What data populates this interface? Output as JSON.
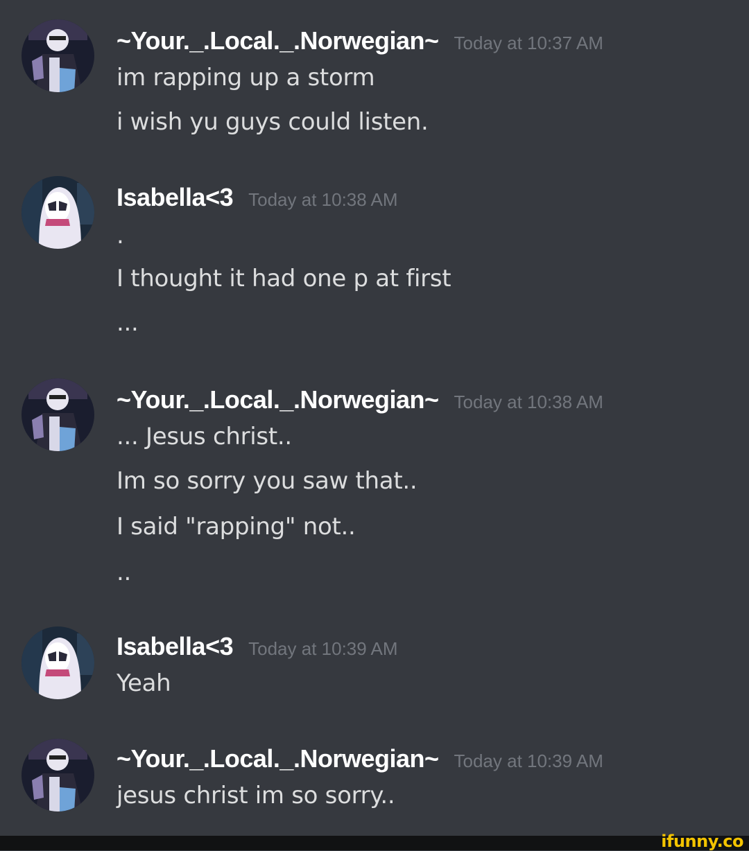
{
  "messages": [
    {
      "username": "~Your._.Local._.Norwegian~",
      "timestamp": "Today at 10:37 AM",
      "avatar_icon": "anime-character-avatar",
      "lines": [
        "im rapping up a storm",
        "i wish yu guys could listen."
      ]
    },
    {
      "username": "Isabella<3",
      "timestamp": "Today at 10:38 AM",
      "avatar_icon": "spider-gwen-avatar",
      "lines": [
        ".",
        "I thought it had one p at first",
        "..."
      ]
    },
    {
      "username": "~Your._.Local._.Norwegian~",
      "timestamp": "Today at 10:38 AM",
      "avatar_icon": "anime-character-avatar",
      "lines": [
        "... Jesus christ..",
        "Im so sorry you saw that..",
        "I said \"rapping\" not..",
        ".."
      ]
    },
    {
      "username": "Isabella<3",
      "timestamp": "Today at 10:39 AM",
      "avatar_icon": "spider-gwen-avatar",
      "lines": [
        "Yeah"
      ]
    },
    {
      "username": "~Your._.Local._.Norwegian~",
      "timestamp": "Today at 10:39 AM",
      "avatar_icon": "anime-character-avatar",
      "lines": [
        "jesus christ im so sorry.."
      ]
    }
  ],
  "watermark": "ifunny.co",
  "colors": {
    "background": "#36393f",
    "username": "#ffffff",
    "timestamp": "#72767d",
    "message_text": "#dcddde",
    "watermark": "#f4c400"
  }
}
